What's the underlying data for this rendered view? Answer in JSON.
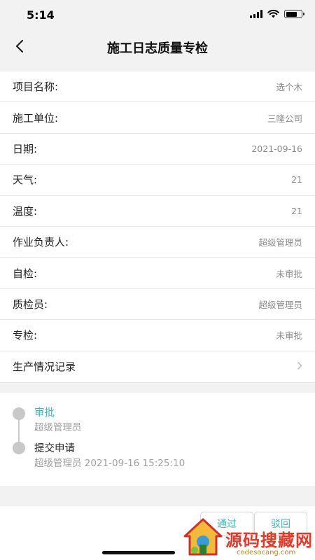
{
  "status_bar": {
    "time": "5:14"
  },
  "nav": {
    "title": "施工日志质量专检"
  },
  "form_rows": [
    {
      "label": "项目名称:",
      "value": "选个木"
    },
    {
      "label": "施工单位:",
      "value": "三隆公司"
    },
    {
      "label": "日期:",
      "value": "2021-09-16"
    },
    {
      "label": "天气:",
      "value": "21"
    },
    {
      "label": "温度:",
      "value": "21"
    },
    {
      "label": "作业负责人:",
      "value": "超级管理员"
    },
    {
      "label": "自检:",
      "value": "未审批"
    },
    {
      "label": "质检员:",
      "value": "超级管理员"
    },
    {
      "label": "专检:",
      "value": "未审批"
    },
    {
      "label": "生产情况记录",
      "value": ""
    }
  ],
  "timeline": [
    {
      "title": "审批",
      "subtitle": "超级管理员"
    },
    {
      "title": "提交申请",
      "subtitle": "超级管理员 2021-09-16 15:25:10"
    }
  ],
  "actions": {
    "approve_label": "通过",
    "reject_label": "驳回"
  },
  "watermark": {
    "text": "源码搜藏网",
    "subtext": "codesocang.com"
  },
  "colors": {
    "accent": "#3fb3b1",
    "background": "#f2f2f2",
    "watermark_red": "#e03a2a"
  }
}
